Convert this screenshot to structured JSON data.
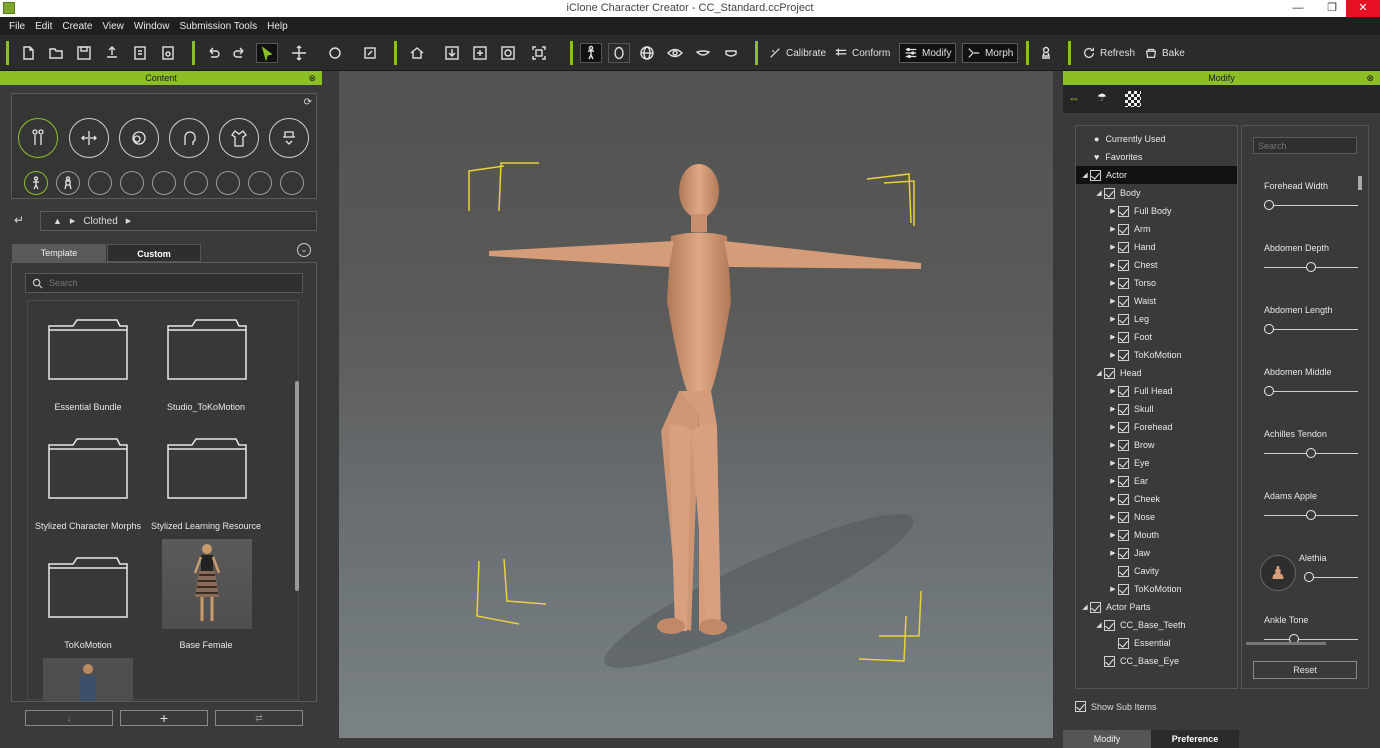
{
  "window": {
    "title": "iClone Character Creator - CC_Standard.ccProject"
  },
  "menu": [
    "File",
    "Edit",
    "Create",
    "View",
    "Window",
    "Submission Tools",
    "Help"
  ],
  "toolbar": {
    "calibrate": "Calibrate",
    "conform": "Conform",
    "modify": "Modify",
    "morph": "Morph",
    "refresh": "Refresh",
    "bake": "Bake"
  },
  "content": {
    "header": "Content",
    "breadcrumb": "Clothed",
    "tabs": {
      "template": "Template",
      "custom": "Custom"
    },
    "search_placeholder": "Search",
    "items": [
      {
        "label": "Essential Bundle",
        "kind": "folder"
      },
      {
        "label": "Studio_ToKoMotion",
        "kind": "folder"
      },
      {
        "label": "Stylized Character Morphs",
        "kind": "folder"
      },
      {
        "label": "Stylized Learning Resource",
        "kind": "folder"
      },
      {
        "label": "ToKoMotion",
        "kind": "folder"
      },
      {
        "label": "Base Female",
        "kind": "thumbnail"
      }
    ]
  },
  "modify": {
    "header": "Modify",
    "tree": [
      {
        "label": "Currently Used",
        "depth": 0,
        "type": "bullet"
      },
      {
        "label": "Favorites",
        "depth": 0,
        "type": "heart"
      },
      {
        "label": "Actor",
        "depth": 0,
        "type": "open",
        "selected": true
      },
      {
        "label": "Body",
        "depth": 1,
        "type": "open"
      },
      {
        "label": "Full Body",
        "depth": 2,
        "type": "closed"
      },
      {
        "label": "Arm",
        "depth": 2,
        "type": "closed"
      },
      {
        "label": "Hand",
        "depth": 2,
        "type": "closed"
      },
      {
        "label": "Chest",
        "depth": 2,
        "type": "closed"
      },
      {
        "label": "Torso",
        "depth": 2,
        "type": "closed"
      },
      {
        "label": "Waist",
        "depth": 2,
        "type": "closed"
      },
      {
        "label": "Leg",
        "depth": 2,
        "type": "closed"
      },
      {
        "label": "Foot",
        "depth": 2,
        "type": "closed"
      },
      {
        "label": "ToKoMotion",
        "depth": 2,
        "type": "closed"
      },
      {
        "label": "Head",
        "depth": 1,
        "type": "open"
      },
      {
        "label": "Full Head",
        "depth": 2,
        "type": "closed"
      },
      {
        "label": "Skull",
        "depth": 2,
        "type": "closed"
      },
      {
        "label": "Forehead",
        "depth": 2,
        "type": "closed"
      },
      {
        "label": "Brow",
        "depth": 2,
        "type": "closed"
      },
      {
        "label": "Eye",
        "depth": 2,
        "type": "closed"
      },
      {
        "label": "Ear",
        "depth": 2,
        "type": "closed"
      },
      {
        "label": "Cheek",
        "depth": 2,
        "type": "closed"
      },
      {
        "label": "Nose",
        "depth": 2,
        "type": "closed"
      },
      {
        "label": "Mouth",
        "depth": 2,
        "type": "closed"
      },
      {
        "label": "Jaw",
        "depth": 2,
        "type": "closed"
      },
      {
        "label": "Cavity",
        "depth": 2,
        "type": "leaf"
      },
      {
        "label": "ToKoMotion",
        "depth": 2,
        "type": "closed"
      },
      {
        "label": "Actor Parts",
        "depth": 0,
        "type": "open"
      },
      {
        "label": "CC_Base_Teeth",
        "depth": 1,
        "type": "open"
      },
      {
        "label": "Essential",
        "depth": 2,
        "type": "leaf"
      },
      {
        "label": "CC_Base_Eye",
        "depth": 1,
        "type": "leaf"
      }
    ],
    "show_sub_items": "Show Sub Items",
    "search_placeholder": "Search",
    "sliders": [
      {
        "label": "Forehead Width",
        "value": 0
      },
      {
        "label": "Abdomen Depth",
        "value": 0.5
      },
      {
        "label": "Abdomen Length",
        "value": 0
      },
      {
        "label": "Abdomen Middle",
        "value": 0
      },
      {
        "label": "Achilles Tendon",
        "value": 0.5
      },
      {
        "label": "Adams Apple",
        "value": 0.5
      },
      {
        "label": "Alethia",
        "value": 0
      },
      {
        "label": "Ankle Tone",
        "value": 0.3
      }
    ],
    "reset": "Reset",
    "bottom_tabs": {
      "modify": "Modify",
      "preference": "Preference"
    }
  },
  "colors": {
    "accent": "#8cbf26",
    "close": "#e81123"
  }
}
